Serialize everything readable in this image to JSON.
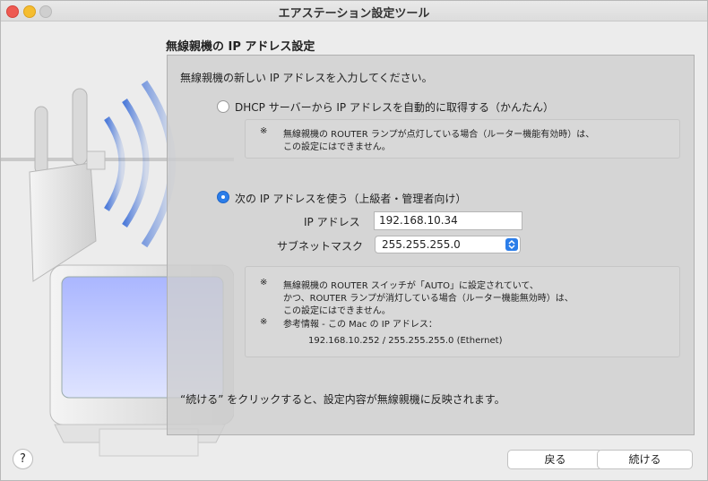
{
  "window": {
    "title": "エアステーション設定ツール"
  },
  "section_title": "無線親機の IP アドレス設定",
  "intro": "無線親機の新しい IP アドレスを入力してください。",
  "options": {
    "dhcp": {
      "label": "DHCP サーバーから IP アドレスを自動的に取得する（かんたん）",
      "selected": false
    },
    "manual": {
      "label": "次の IP アドレスを使う（上級者・管理者向け）",
      "selected": true
    }
  },
  "note1": {
    "mark": "※",
    "lines": [
      "無線親機の ROUTER ランプが点灯している場合（ルーター機能有効時）は、",
      "この設定にはできません。"
    ]
  },
  "fields": {
    "ip_label": "IP アドレス",
    "ip_value": "192.168.10.34",
    "mask_label": "サブネットマスク",
    "mask_value": "255.255.255.0"
  },
  "note2": {
    "mark1": "※",
    "lines": [
      "無線親機の ROUTER スイッチが「AUTO」に設定されていて、",
      "かつ、ROUTER ランプが消灯している場合（ルーター機能無効時）は、",
      "この設定にはできません。"
    ],
    "mark2": "※",
    "ref_label": "参考情報 - この Mac の IP アドレス：",
    "ref_value": "192.168.10.252 / 255.255.255.0 (Ethernet)"
  },
  "footer_text": "“続ける” をクリックすると、設定内容が無線親機に反映されます。",
  "buttons": {
    "help": "?",
    "back": "戻る",
    "continue": "続ける"
  },
  "colors": {
    "accent": "#2b7de9",
    "close": "#ee5a52",
    "minimize": "#f5bd2f"
  }
}
